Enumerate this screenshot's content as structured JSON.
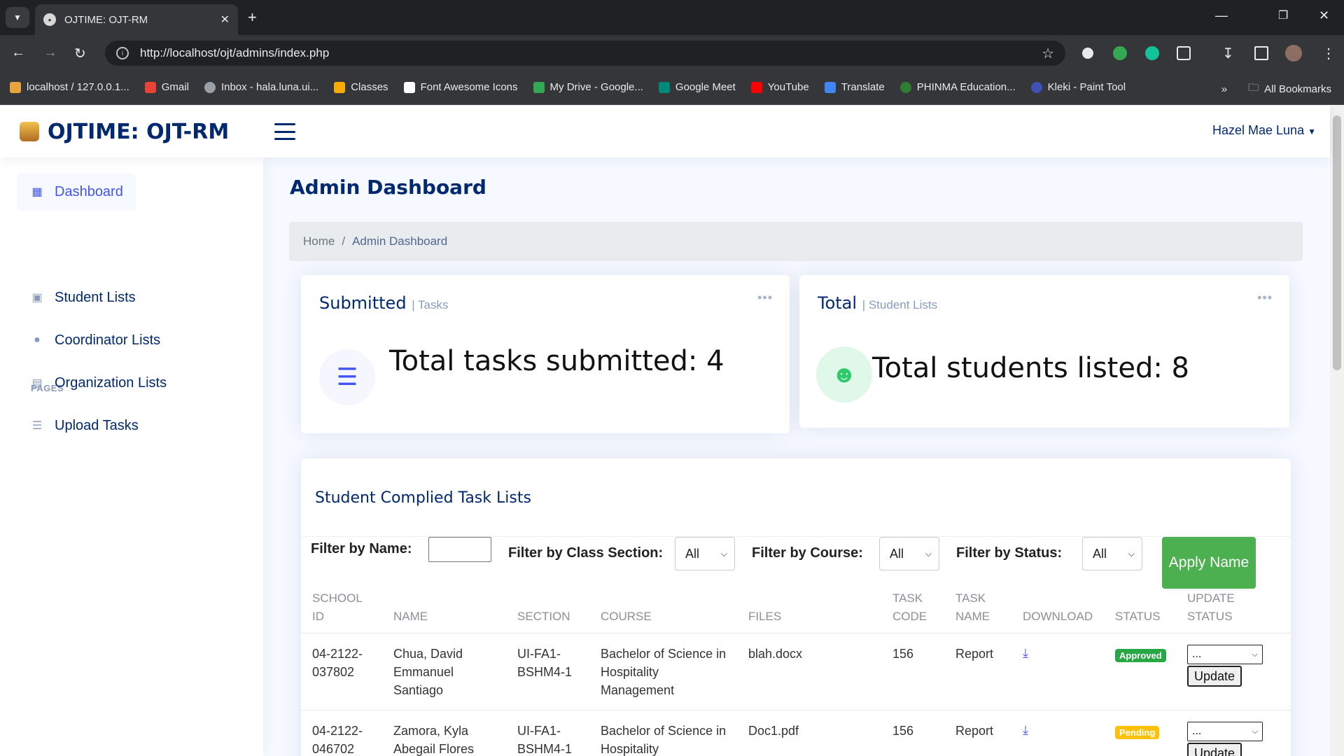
{
  "browser": {
    "tab_title": "OJTIME: OJT-RM",
    "url": "http://localhost/ojt/admins/index.php",
    "bookmarks": [
      {
        "label": "localhost / 127.0.0.1...",
        "color": "#e8a33d"
      },
      {
        "label": "Gmail",
        "color": "#ea4335"
      },
      {
        "label": "Inbox - hala.luna.ui...",
        "color": "#9aa0a6"
      },
      {
        "label": "Classes",
        "color": "#f9ab00"
      },
      {
        "label": "Font Awesome Icons",
        "color": "#ffffff"
      },
      {
        "label": "My Drive - Google...",
        "color": "#34a853"
      },
      {
        "label": "Google Meet",
        "color": "#00897b"
      },
      {
        "label": "YouTube",
        "color": "#ff0000"
      },
      {
        "label": "Translate",
        "color": "#4285f4"
      },
      {
        "label": "PHINMA Education...",
        "color": "#2e7d32"
      },
      {
        "label": "Kleki - Paint Tool",
        "color": "#3f51b5"
      }
    ],
    "all_bookmarks": "All Bookmarks"
  },
  "header": {
    "logo_text": "OJTIME: OJT-RM",
    "user_name": "Hazel Mae Luna"
  },
  "sidebar": {
    "dashboard": "Dashboard",
    "pages_heading": "PAGES",
    "items": [
      {
        "label": "Student Lists",
        "icon": "student-icon"
      },
      {
        "label": "Coordinator Lists",
        "icon": "person-icon"
      },
      {
        "label": "Organization Lists",
        "icon": "building-icon"
      },
      {
        "label": "Upload Tasks",
        "icon": "list-icon"
      }
    ]
  },
  "main": {
    "page_title": "Admin Dashboard",
    "breadcrumb": {
      "home": "Home",
      "current": "Admin Dashboard"
    },
    "cards": {
      "submitted": {
        "title": "Submitted",
        "subtitle": "| Tasks",
        "value": "Total tasks submitted: 4"
      },
      "total": {
        "title": "Total",
        "subtitle": "| Student Lists",
        "value": "Total students listed: 8"
      }
    },
    "tasks": {
      "title": "Student Complied Task Lists",
      "filters": {
        "name_label": "Filter by Name:",
        "section_label": "Filter by Class Section:",
        "section_value": "All",
        "course_label": "Filter by Course:",
        "course_value": "All",
        "status_label": "Filter by Status:",
        "status_value": "All",
        "apply_label": "Apply Name"
      },
      "headers": {
        "school_id": [
          "SCHOOL",
          "ID"
        ],
        "name": "NAME",
        "section": "SECTION",
        "course": "COURSE",
        "files": "FILES",
        "task_code": [
          "TASK",
          "CODE"
        ],
        "task_name": [
          "TASK",
          "NAME"
        ],
        "download": "DOWNLOAD",
        "status": "STATUS",
        "update_status": [
          "UPDATE",
          "STATUS"
        ]
      },
      "rows": [
        {
          "school_id": [
            "04-2122-",
            "037802"
          ],
          "name": [
            "Chua, David",
            "Emmanuel",
            "Santiago"
          ],
          "section": [
            "UI-FA1-",
            "BSHM4-1"
          ],
          "course": [
            "Bachelor of Science in",
            "Hospitality",
            "Management"
          ],
          "file": "blah.docx",
          "task_code": "156",
          "task_name": "Report",
          "status": "Approved",
          "status_color": "#28a745",
          "select_value": "...",
          "update_label": "Update"
        },
        {
          "school_id": [
            "04-2122-",
            "046702"
          ],
          "name": [
            "Zamora, Kyla",
            "Abegail Flores"
          ],
          "section": [
            "UI-FA1-",
            "BSHM4-1"
          ],
          "course": [
            "Bachelor of Science in",
            "Hospitality"
          ],
          "file": "Doc1.pdf",
          "task_code": "156",
          "task_name": "Report",
          "status": "Pending",
          "status_color": "#ffc107",
          "select_value": "...",
          "update_label": "Update"
        }
      ]
    }
  }
}
